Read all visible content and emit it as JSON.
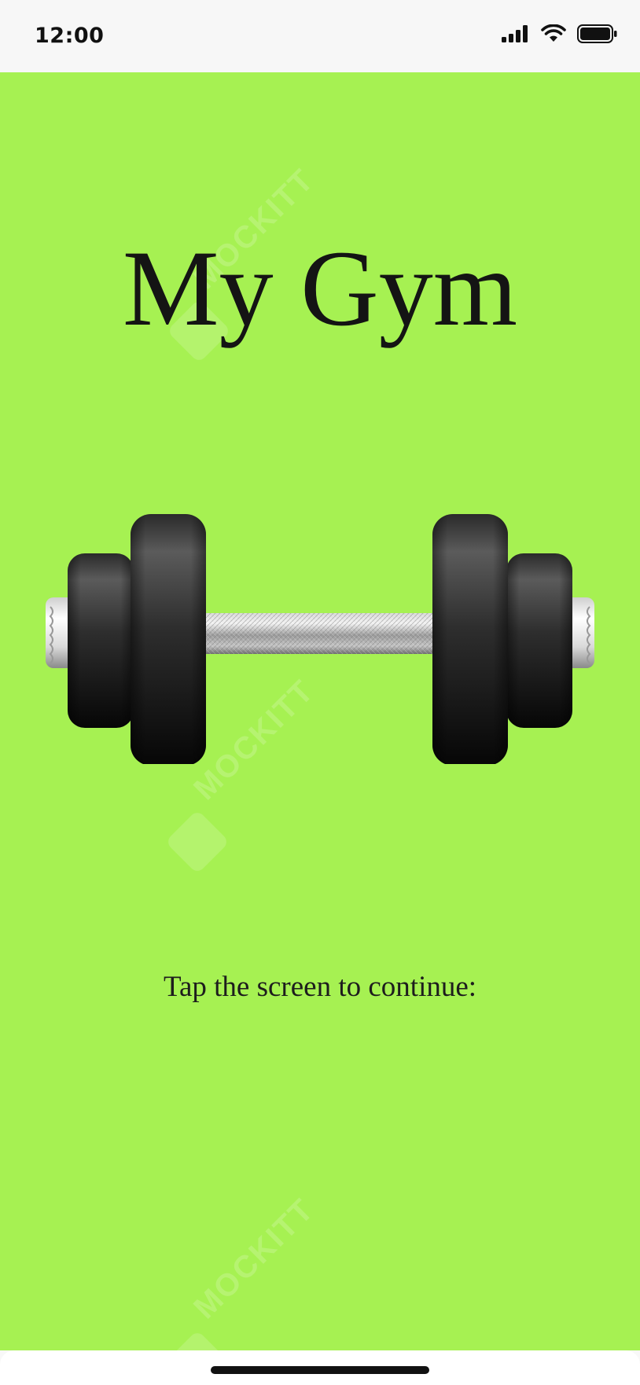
{
  "status_bar": {
    "time": "12:00",
    "icons": [
      "cellular-signal-icon",
      "wifi-icon",
      "battery-icon"
    ]
  },
  "app": {
    "title": "My Gym",
    "illustration": "dumbbell-icon",
    "prompt": "Tap the screen to continue:",
    "background_color": "#a6f152"
  },
  "watermark": {
    "text": "MOCKITT"
  }
}
